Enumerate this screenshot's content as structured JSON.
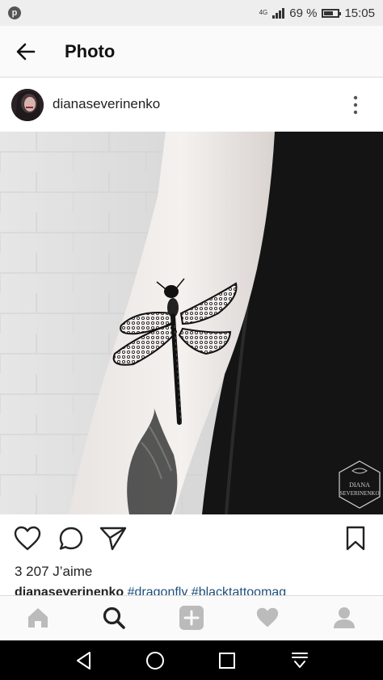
{
  "status_bar": {
    "network": "4G",
    "battery_level": "69 %",
    "time": "15:05",
    "notification_icon": "pinterest-icon",
    "battery_fraction": 0.69
  },
  "app_bar": {
    "title": "Photo",
    "back_icon": "back-arrow-icon"
  },
  "post": {
    "username": "dianaseverinenko",
    "watermark_line1": "DIANA",
    "watermark_line2": "SEVERINENKO",
    "likes_text": "3 207 J’aime",
    "caption_user": "dianaseverinenko",
    "caption_tags": "#dragonfly #blacktattoomag"
  },
  "actions": [
    "heart-icon",
    "comment-icon",
    "share-icon",
    "bookmark-icon"
  ],
  "bottom_nav": [
    "home-icon",
    "search-icon",
    "add-icon",
    "activity-heart-icon",
    "profile-icon"
  ],
  "system_nav": [
    "back-icon",
    "home-circle-icon",
    "recents-icon",
    "notifications-pulldown-icon"
  ],
  "colors": {
    "status_bar": "#eeeeee",
    "app_bar": "#fafafa",
    "hashtag": "#1f4e7a",
    "inactive_nav": "#bbbbbb",
    "active_nav": "#222222",
    "system_nav": "#000000"
  }
}
